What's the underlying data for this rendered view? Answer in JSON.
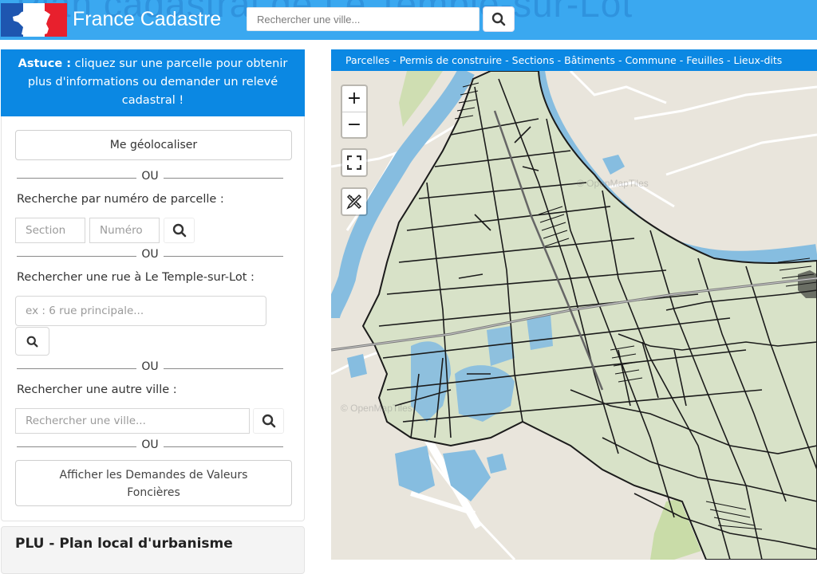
{
  "header": {
    "background_title": "Plan cadastral de Le Temple-sur-Lot",
    "brand": "France Cadastre",
    "search_placeholder": "Rechercher une ville...",
    "search_icon": "search-icon",
    "colors": {
      "bar": "#3aa8f0",
      "flag_blue": "#1e56b0",
      "flag_red": "#e8202d"
    }
  },
  "sidebar": {
    "tip": {
      "label": "Astuce :",
      "text": " cliquez sur une parcelle pour obtenir plus d'informations ou demander un relevé cadastral !"
    },
    "geolocate_label": "Me géolocaliser",
    "or_label": "OU",
    "parcel_search": {
      "label": "Recherche par numéro de parcelle :",
      "section_placeholder": "Section",
      "number_placeholder": "Numéro"
    },
    "street_search": {
      "label": "Rechercher une rue à Le Temple-sur-Lot :",
      "placeholder": "ex : 6 rue principale..."
    },
    "city_search": {
      "label": "Rechercher une autre ville :",
      "placeholder": "Rechercher une ville..."
    },
    "dvf_button_line1": "Afficher les Demandes de Valeurs",
    "dvf_button_line2": "Foncières",
    "plu_title": "PLU - Plan local d'urbanisme"
  },
  "map": {
    "layers": [
      "Parcelles",
      "Permis de construire",
      "Sections",
      "Bâtiments",
      "Commune",
      "Feuilles",
      "Lieux-dits"
    ],
    "layer_separator": "-",
    "controls": {
      "zoom_in": "+",
      "zoom_out": "−",
      "fullscreen_icon": "fullscreen-icon",
      "draw_icon": "ruler-pencil-icon"
    },
    "attribution": "© OpenMapTiles",
    "attribution_partial": "© OpenMapTiles",
    "colors": {
      "land": "#e9e5dc",
      "water": "#86bde0",
      "parcel_fill": "#d8e2c8",
      "parcel_line": "#1b1b1b",
      "forest": "#c9dca8"
    }
  }
}
